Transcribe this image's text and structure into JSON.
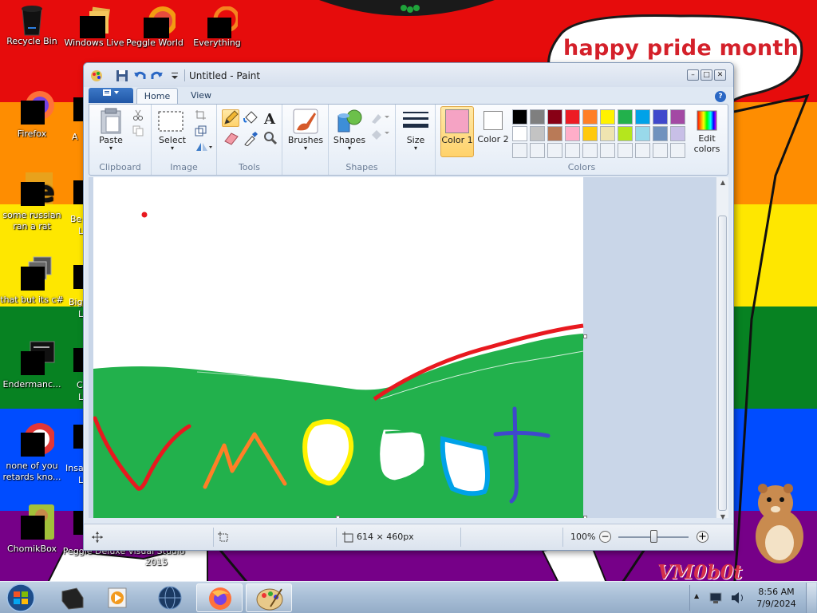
{
  "desktop": {
    "bubble_text": "happy pride month",
    "watermark": "VM0b0t",
    "icons": [
      {
        "label": "Recycle Bin"
      },
      {
        "label": "Windows Live"
      },
      {
        "label": "Peggle World"
      },
      {
        "label": "Everything"
      },
      {
        "label": "Firefox"
      },
      {
        "label": "some russian ran a rat"
      },
      {
        "label": "that but its c#"
      },
      {
        "label": "Endermanc..."
      },
      {
        "label": "none of you retards kno..."
      },
      {
        "label": "ChomikBox"
      },
      {
        "label": "Peggle Deluxe"
      },
      {
        "label": "Visual Studio 2015"
      }
    ],
    "partial_labels": [
      "A",
      "Be",
      "Big",
      "C",
      "Insa",
      "L",
      "L",
      "L",
      "L"
    ]
  },
  "window": {
    "title": "Untitled - Paint",
    "controls": {
      "minimize": "–",
      "maximize": "□",
      "close": "✕"
    },
    "tabs": [
      {
        "label": "Home",
        "active": true
      },
      {
        "label": "View",
        "active": false
      }
    ],
    "help": "?",
    "ribbon": {
      "clipboard": {
        "group": "Clipboard",
        "paste": "Paste"
      },
      "image": {
        "group": "Image",
        "select": "Select"
      },
      "tools": {
        "group": "Tools"
      },
      "brushes": {
        "label": "Brushes"
      },
      "shapes": {
        "group": "Shapes",
        "label": "Shapes"
      },
      "size": {
        "label": "Size"
      },
      "colors": {
        "group": "Colors",
        "color1_label": "Color 1",
        "color2_label": "Color 2",
        "color1": "#f5a3c4",
        "color2": "#ffffff",
        "edit_label": "Edit colors",
        "palette_row1": [
          "#000000",
          "#7f7f7f",
          "#880015",
          "#ed1c24",
          "#ff7f27",
          "#fff200",
          "#22b14c",
          "#00a2e8",
          "#3f48cc",
          "#a349a4"
        ],
        "palette_row2": [
          "#ffffff",
          "#c3c3c3",
          "#b97a57",
          "#ffaec9",
          "#ffc90e",
          "#efe4b0",
          "#b5e61d",
          "#99d9ea",
          "#7092be",
          "#c8bfe7"
        ]
      }
    },
    "status": {
      "dimensions": "614 × 460px",
      "zoom": "100%"
    }
  },
  "taskbar": {
    "time": "8:56 AM",
    "date": "7/9/2024"
  }
}
